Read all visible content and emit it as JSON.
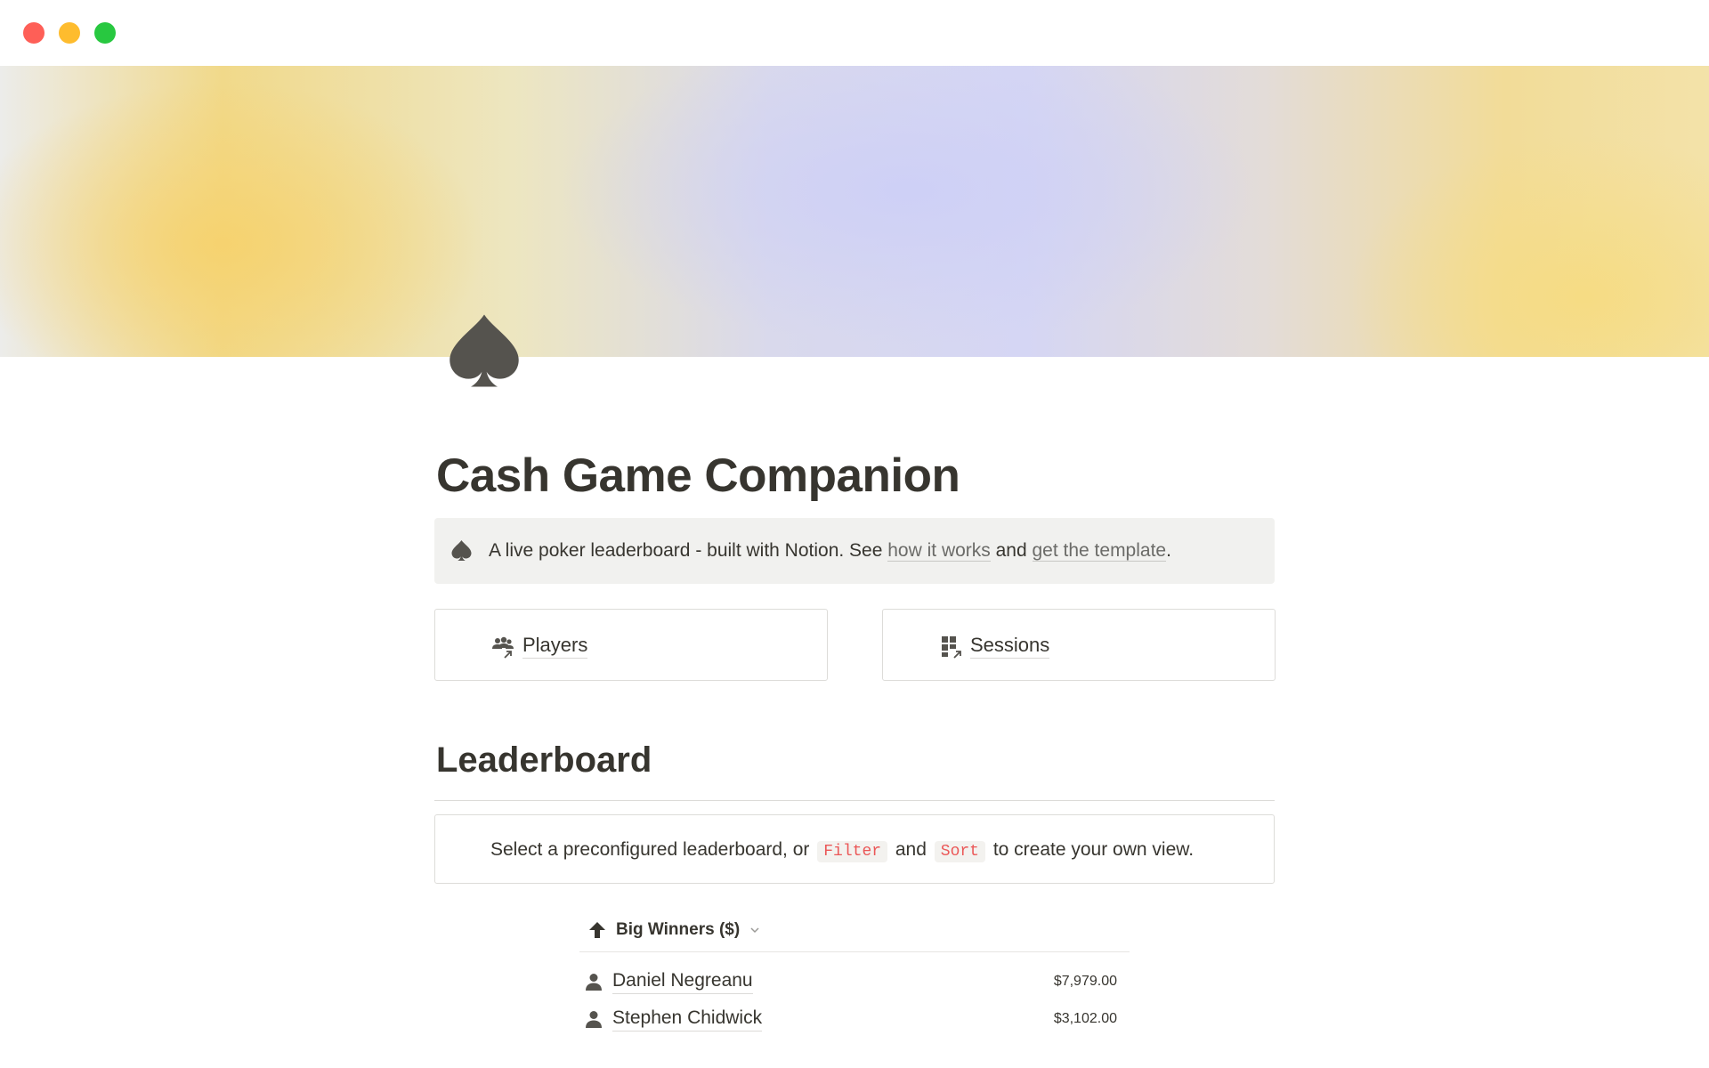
{
  "window": {
    "controls": [
      "close",
      "minimize",
      "maximize"
    ]
  },
  "page": {
    "icon": "spade-icon",
    "title": "Cash Game Companion"
  },
  "callout": {
    "icon": "spade-icon",
    "text_before": "A live poker leaderboard - built with Notion. See ",
    "link1": "how it works",
    "text_middle": " and ",
    "link2": "get the template",
    "text_after": "."
  },
  "links": {
    "players": {
      "label": "Players",
      "icon": "people-link-icon"
    },
    "sessions": {
      "label": "Sessions",
      "icon": "grid-link-icon"
    }
  },
  "leaderboard": {
    "heading": "Leaderboard",
    "hint_before": "Select a preconfigured leaderboard, or ",
    "hint_filter": "Filter",
    "hint_and": " and ",
    "hint_sort": "Sort",
    "hint_after": " to create your own view.",
    "view": {
      "icon": "arrow-up-icon",
      "label": "Big Winners ($)"
    },
    "rows": [
      {
        "name": "Daniel Negreanu",
        "amount": "$7,979.00"
      },
      {
        "name": "Stephen Chidwick",
        "amount": "$3,102.00"
      }
    ]
  },
  "colors": {
    "text": "#37352f",
    "callout_bg": "#f1f1ef",
    "code_red": "#eb5757",
    "close": "#fe5f57",
    "minimize": "#febc2e",
    "maximize": "#28c840"
  }
}
